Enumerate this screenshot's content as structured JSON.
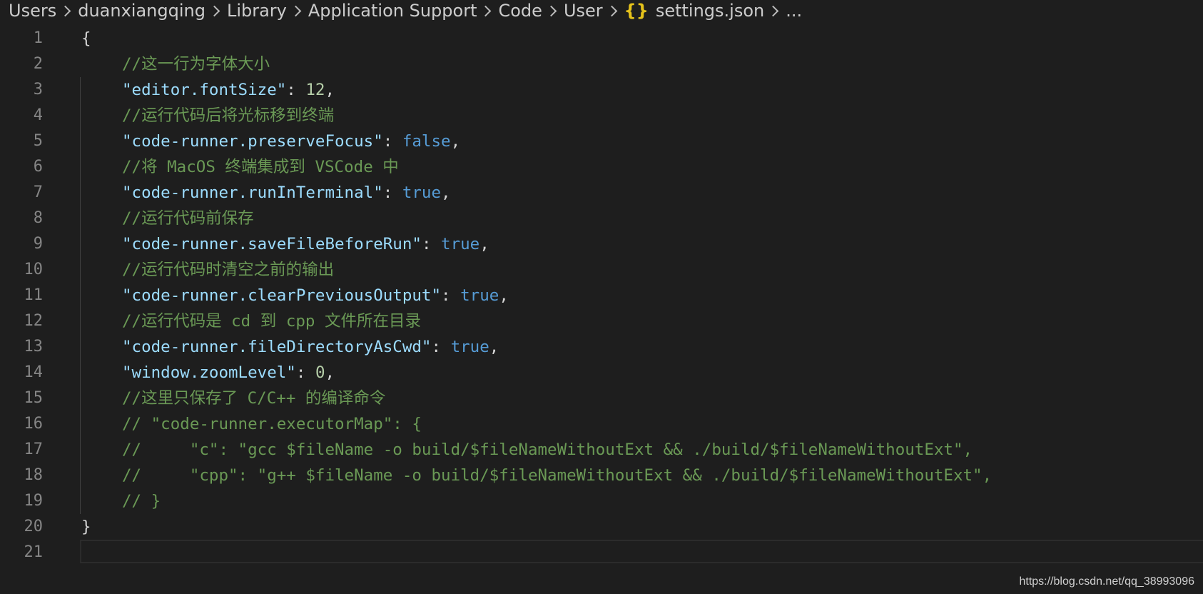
{
  "breadcrumb": {
    "items": [
      "Users",
      "duanxiangqing",
      "Library",
      "Application Support",
      "Code",
      "User"
    ],
    "file_icon": "{}",
    "file_name": "settings.json",
    "ellipsis": "..."
  },
  "editor": {
    "lines": [
      {
        "num": "1",
        "text": "{"
      },
      {
        "num": "2",
        "comment": "//这一行为字体大小"
      },
      {
        "num": "3",
        "key": "\"editor.fontSize\"",
        "colon": ": ",
        "value": "12",
        "value_type": "number",
        "tail": ","
      },
      {
        "num": "4",
        "comment": "//运行代码后将光标移到终端"
      },
      {
        "num": "5",
        "key": "\"code-runner.preserveFocus\"",
        "colon": ": ",
        "value": "false",
        "value_type": "bool",
        "tail": ","
      },
      {
        "num": "6",
        "comment": "//将 MacOS 终端集成到 VSCode 中"
      },
      {
        "num": "7",
        "key": "\"code-runner.runInTerminal\"",
        "colon": ": ",
        "value": "true",
        "value_type": "bool",
        "tail": ","
      },
      {
        "num": "8",
        "comment": "//运行代码前保存"
      },
      {
        "num": "9",
        "key": "\"code-runner.saveFileBeforeRun\"",
        "colon": ": ",
        "value": "true",
        "value_type": "bool",
        "tail": ","
      },
      {
        "num": "10",
        "comment": "//运行代码时清空之前的输出"
      },
      {
        "num": "11",
        "key": "\"code-runner.clearPreviousOutput\"",
        "colon": ": ",
        "value": "true",
        "value_type": "bool",
        "tail": ","
      },
      {
        "num": "12",
        "comment": "//运行代码是 cd 到 cpp 文件所在目录"
      },
      {
        "num": "13",
        "key": "\"code-runner.fileDirectoryAsCwd\"",
        "colon": ": ",
        "value": "true",
        "value_type": "bool",
        "tail": ","
      },
      {
        "num": "14",
        "key": "\"window.zoomLevel\"",
        "colon": ": ",
        "value": "0",
        "value_type": "number",
        "tail": ","
      },
      {
        "num": "15",
        "comment": "//这里只保存了 C/C++ 的编译命令"
      },
      {
        "num": "16",
        "comment": "// \"code-runner.executorMap\": {"
      },
      {
        "num": "17",
        "comment": "//     \"c\": \"gcc $fileName -o build/$fileNameWithoutExt && ./build/$fileNameWithoutExt\","
      },
      {
        "num": "18",
        "comment": "//     \"cpp\": \"g++ $fileName -o build/$fileNameWithoutExt && ./build/$fileNameWithoutExt\","
      },
      {
        "num": "19",
        "comment": "// }"
      },
      {
        "num": "20",
        "text": "}"
      },
      {
        "num": "21",
        "text": ""
      }
    ]
  },
  "watermark": "https://blog.csdn.net/qq_38993096"
}
